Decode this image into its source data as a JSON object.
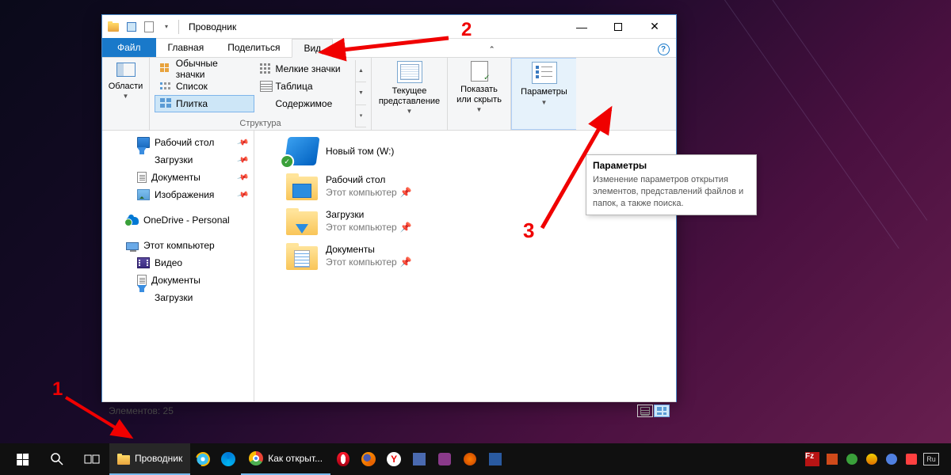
{
  "window": {
    "title": "Проводник",
    "tabs": {
      "file": "Файл",
      "home": "Главная",
      "share": "Поделиться",
      "view": "Вид"
    },
    "ribbon": {
      "areas_label": "Области",
      "layout_group_label": "Структура",
      "layouts": {
        "regular": "Обычные значки",
        "small": "Мелкие значки",
        "list": "Список",
        "table": "Таблица",
        "tiles": "Плитка",
        "content": "Содержимое"
      },
      "current_view": "Текущее\nпредставление",
      "show_hide": "Показать\nили скрыть",
      "options": "Параметры"
    },
    "sidebar": {
      "desktop": "Рабочий стол",
      "downloads": "Загрузки",
      "documents": "Документы",
      "pictures": "Изображения",
      "onedrive": "OneDrive - Personal",
      "thispc": "Этот компьютер",
      "videos": "Видео"
    },
    "items": {
      "drive": {
        "name": "Новый том (W:)"
      },
      "desktop": {
        "name": "Рабочий стол",
        "loc": "Этот компьютер"
      },
      "downloads": {
        "name": "Загрузки",
        "loc": "Этот компьютер"
      },
      "documents": {
        "name": "Документы",
        "loc": "Этот компьютер"
      }
    },
    "status": "Элементов: 25"
  },
  "tooltip": {
    "title": "Параметры",
    "body": "Изменение параметров открытия элементов, представлений файлов и папок, а также поиска."
  },
  "annotations": {
    "a1": "1",
    "a2": "2",
    "a3": "3"
  },
  "taskbar": {
    "explorer": "Проводник",
    "browser_tab": "Как открыт...",
    "lang": "Ru"
  }
}
